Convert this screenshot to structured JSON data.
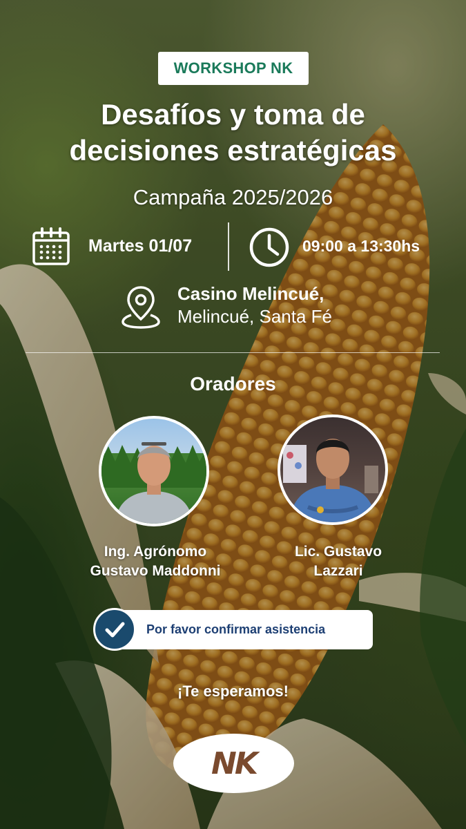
{
  "badge": {
    "label": "WORKSHOP NK"
  },
  "title": {
    "line1": "Desafíos y toma de",
    "line2": "decisiones estratégicas"
  },
  "subtitle": "Campaña 2025/2026",
  "event": {
    "date": "Martes 01/07",
    "time": "09:00 a 13:30hs",
    "venue_name": "Casino Melincué,",
    "venue_location": "Melincué, Santa Fé"
  },
  "speakers": {
    "title": "Oradores",
    "list": [
      {
        "line1": "Ing. Agrónomo",
        "line2": "Gustavo Maddonni"
      },
      {
        "line1": "Lic. Gustavo",
        "line2": "Lazzari"
      }
    ]
  },
  "cta": {
    "label": "Por favor confirmar asistencia"
  },
  "closing": "¡Te esperamos!",
  "logo": {
    "text": "NK"
  },
  "colors": {
    "brand_green": "#1a7a5a",
    "cta_text": "#1d3f73",
    "logo_brown": "#7a4a2e",
    "corn": "#d9932a"
  },
  "icons": [
    "calendar-icon",
    "clock-icon",
    "location-pin-icon",
    "check-icon"
  ]
}
